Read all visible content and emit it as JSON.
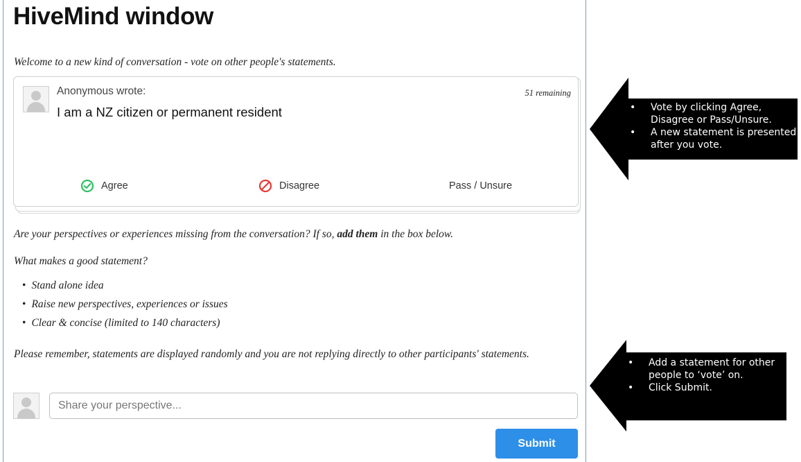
{
  "window": {
    "title": "HiveMind window",
    "welcome": "Welcome to a new kind of conversation - vote on other people's statements."
  },
  "card": {
    "author": "Anonymous wrote:",
    "remaining": "51 remaining",
    "statement": "I am a NZ citizen or permanent resident",
    "votes": {
      "agree": "Agree",
      "disagree": "Disagree",
      "pass": "Pass / Unsure"
    }
  },
  "compose": {
    "prompt_start": "Are your perspectives or experiences missing from the conversation? If so, ",
    "prompt_bold": "add them",
    "prompt_end": " in the box below.",
    "good_heading": "What makes a good statement?",
    "tips": [
      "Stand alone idea",
      "Raise new perspectives, experiences or issues",
      "Clear & concise (limited to 140 characters)"
    ],
    "reminder": "Please remember, statements are displayed randomly and you are not replying directly to other participants' statements.",
    "placeholder": "Share your perspective...",
    "submit_label": "Submit"
  },
  "callouts": {
    "vote": [
      "Vote by clicking Agree, Disagree or Pass/Unsure.",
      "A new statement is presented after you vote."
    ],
    "add": [
      "Add a statement for other people to ‘vote’ on.",
      "Click Submit."
    ]
  },
  "colors": {
    "agree": "#2ebf63",
    "disagree": "#e53935",
    "submit": "#2d8fe8",
    "callout": "#000000"
  },
  "icons": {
    "agree": "check-circle-icon",
    "disagree": "no-entry-icon",
    "avatar": "user-silhouette-icon"
  }
}
